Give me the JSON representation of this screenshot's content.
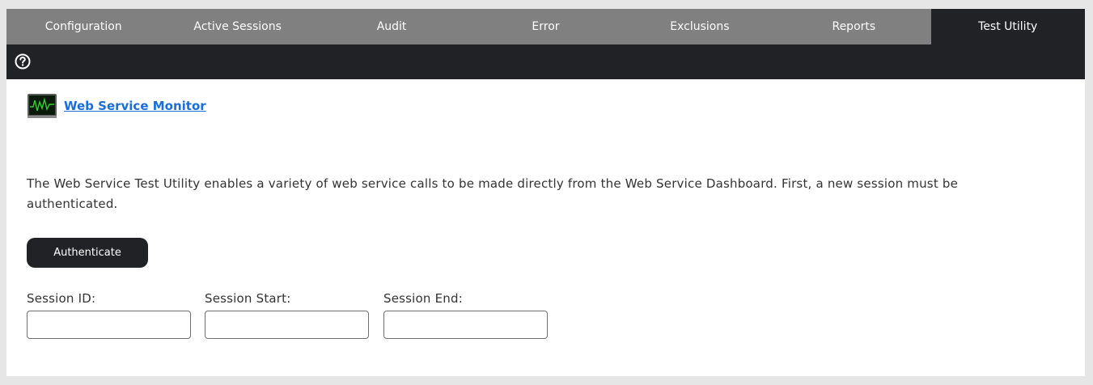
{
  "tabs": [
    {
      "label": "Configuration"
    },
    {
      "label": "Active Sessions"
    },
    {
      "label": "Audit"
    },
    {
      "label": "Error"
    },
    {
      "label": "Exclusions"
    },
    {
      "label": "Reports"
    },
    {
      "label": "Test Utility"
    }
  ],
  "active_tab": "Test Utility",
  "toolbar": {
    "help_icon": "help-icon"
  },
  "monitor": {
    "icon": "monitor-icon",
    "link_label": "Web Service Monitor"
  },
  "description": "The Web Service Test Utility enables a variety of web service calls to be made directly from the Web Service Dashboard. First, a new session must be authenticated.",
  "authenticate_label": "Authenticate",
  "fields": {
    "session_id": {
      "label": "Session ID:",
      "value": ""
    },
    "session_start": {
      "label": "Session Start:",
      "value": ""
    },
    "session_end": {
      "label": "Session End:",
      "value": ""
    }
  },
  "colors": {
    "accent_link": "#1a6ed8",
    "dark_bar": "#202226",
    "tab_bar": "#808080"
  }
}
